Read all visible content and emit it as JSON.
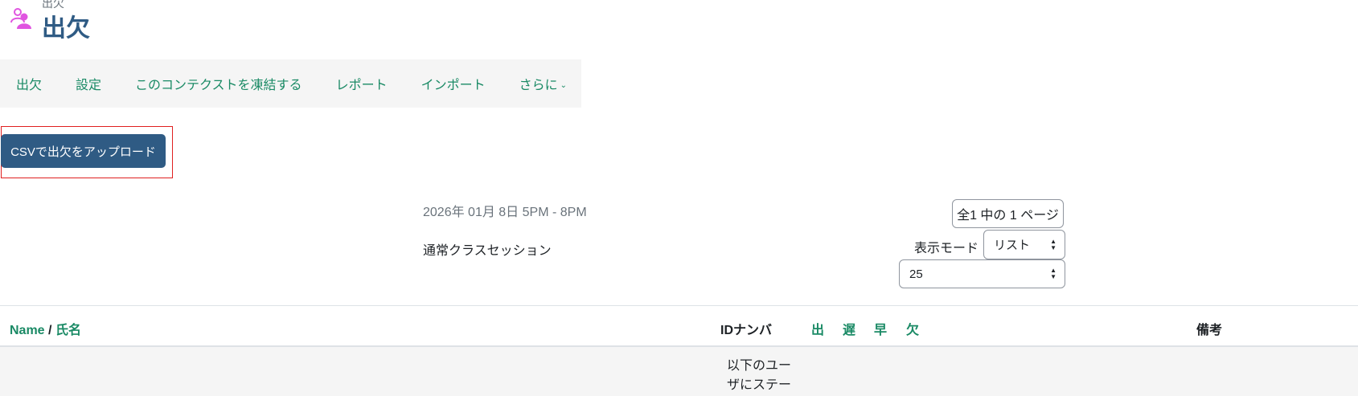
{
  "header": {
    "pretitle": "出欠",
    "title": "出欠",
    "icon": "attendance-people-icon",
    "icon_color": "#e055e0"
  },
  "nav": {
    "items": [
      {
        "label": "出欠"
      },
      {
        "label": "設定"
      },
      {
        "label": "このコンテクストを凍結する"
      },
      {
        "label": "レポート"
      },
      {
        "label": "インポート"
      },
      {
        "label": "さらに",
        "icon": "chevron-down-icon"
      }
    ]
  },
  "upload_button": {
    "label": "CSVで出欠をアップロード"
  },
  "session": {
    "date": "2026年 01月 8日 5PM - 8PM",
    "type": "通常クラスセッション"
  },
  "pagination": {
    "label": "全1 中の 1 ページ"
  },
  "view_mode": {
    "label": "表示モード",
    "selected": "リスト"
  },
  "per_page": {
    "selected": "25"
  },
  "table": {
    "headers": {
      "name_en": "Name",
      "separator": "/",
      "name_ja": "氏名",
      "id_number": "IDナンバ",
      "statuses": [
        "出",
        "遅",
        "早",
        "欠"
      ],
      "remarks": "備考"
    },
    "notice": "以下のユーザにステー"
  },
  "colors": {
    "accent_link": "#1a8a65",
    "primary": "#2f5b84",
    "highlight_frame": "#e02020",
    "nav_bg": "#f5f5f5"
  }
}
